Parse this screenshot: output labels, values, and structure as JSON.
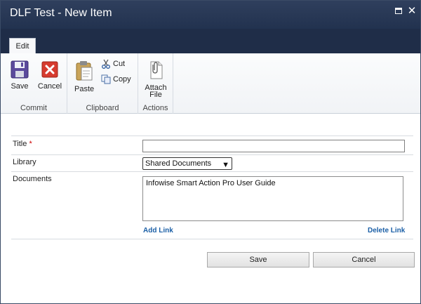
{
  "window": {
    "title": "DLF Test - New Item"
  },
  "ribbon": {
    "tab_label": "Edit",
    "groups": {
      "commit": {
        "label": "Commit",
        "save_label": "Save",
        "cancel_label": "Cancel"
      },
      "clipboard": {
        "label": "Clipboard",
        "paste_label": "Paste",
        "cut_label": "Cut",
        "copy_label": "Copy"
      },
      "actions": {
        "label": "Actions",
        "attach_line1": "Attach",
        "attach_line2": "File"
      }
    }
  },
  "form": {
    "title_label": "Title",
    "required_marker": "*",
    "title_value": "",
    "library_label": "Library",
    "library_selected": "Shared Documents",
    "documents_label": "Documents",
    "documents": [
      "Infowise Smart Action Pro User Guide"
    ],
    "add_link": "Add Link",
    "delete_link": "Delete Link"
  },
  "footer": {
    "save_label": "Save",
    "cancel_label": "Cancel"
  },
  "colors": {
    "titlebar": "#2f3f5d",
    "link": "#1b5fa6",
    "required": "#cc0000"
  }
}
